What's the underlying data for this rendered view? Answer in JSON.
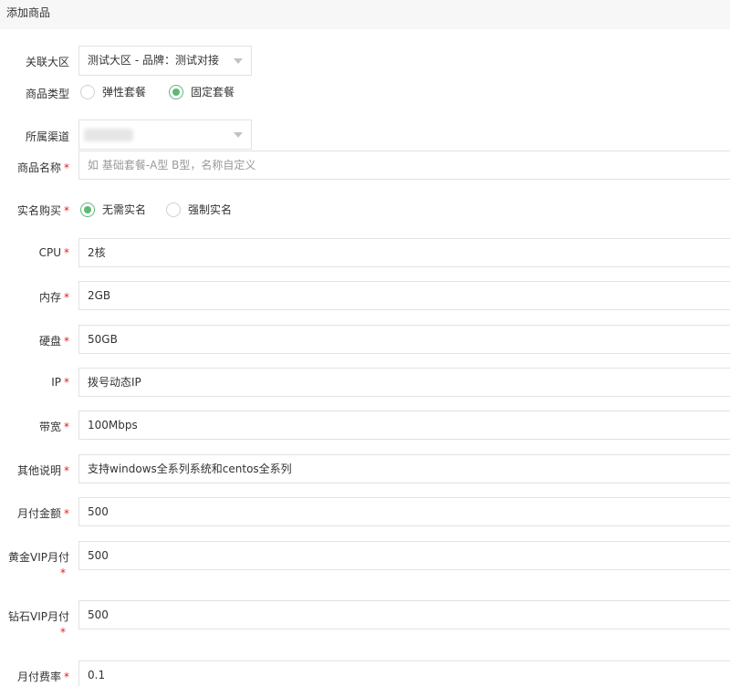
{
  "header": {
    "title": "添加商品"
  },
  "form": {
    "region": {
      "label": "关联大区",
      "value": "测试大区 - 品牌：测试对接"
    },
    "product_type": {
      "label": "商品类型",
      "options": [
        {
          "label": "弹性套餐",
          "checked": false
        },
        {
          "label": "固定套餐",
          "checked": true
        }
      ]
    },
    "channel": {
      "label": "所属渠道",
      "value": ""
    },
    "name": {
      "label": "商品名称",
      "required": "*",
      "placeholder": "如 基础套餐-A型  B型，名称自定义"
    },
    "realname": {
      "label": "实名购买",
      "required": "*",
      "options": [
        {
          "label": "无需实名",
          "checked": true
        },
        {
          "label": "强制实名",
          "checked": false
        }
      ]
    },
    "cpu": {
      "label": "CPU",
      "required": "*",
      "value": "2核"
    },
    "memory": {
      "label": "内存",
      "required": "*",
      "value": "2GB"
    },
    "disk": {
      "label": "硬盘",
      "required": "*",
      "value": "50GB"
    },
    "ip": {
      "label": "IP",
      "required": "*",
      "value": "拨号动态IP"
    },
    "bandwidth": {
      "label": "带宽",
      "required": "*",
      "value": "100Mbps"
    },
    "notes": {
      "label": "其他说明",
      "required": "*",
      "value": "支持windows全系列系统和centos全系列"
    },
    "monthly_price": {
      "label": "月付金额",
      "required": "*",
      "value": "500"
    },
    "gold_vip": {
      "label": "黄金VIP月付",
      "required": "*",
      "value": "500"
    },
    "diamond_vip": {
      "label": "钻石VIP月付",
      "required": "*",
      "value": "500"
    },
    "monthly_rate": {
      "label": "月付费率",
      "required": "*",
      "value": "0.1"
    }
  },
  "colors": {
    "accent": "#5fb878",
    "required": "#e02020",
    "border": "#e2e2e2"
  }
}
